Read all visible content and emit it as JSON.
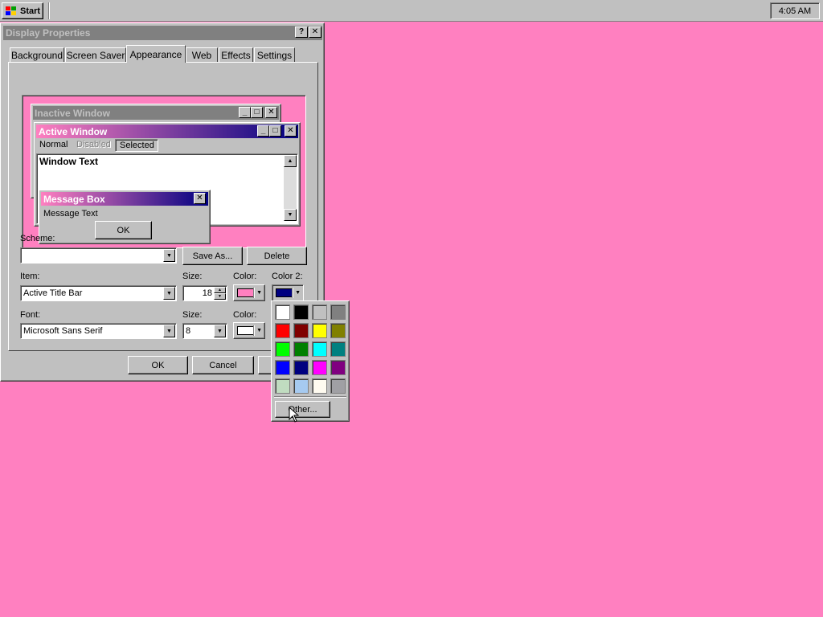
{
  "taskbar": {
    "start_label": "Start",
    "clock": "4:05 AM"
  },
  "dialog": {
    "title": "Display Properties",
    "help_btn": "?",
    "close_btn": "✕",
    "tabs": [
      {
        "label": "Background"
      },
      {
        "label": "Screen Saver"
      },
      {
        "label": "Appearance",
        "active": true
      },
      {
        "label": "Web"
      },
      {
        "label": "Effects"
      },
      {
        "label": "Settings"
      }
    ],
    "preview": {
      "inactive_title": "Inactive Window",
      "active_title": "Active Window",
      "menu_normal": "Normal",
      "menu_disabled": "Disabled",
      "menu_selected": "Selected",
      "window_text": "Window Text",
      "msgbox_title": "Message Box",
      "msgbox_text": "Message Text",
      "msgbox_ok": "OK"
    },
    "scheme": {
      "label": "Scheme:",
      "value": "",
      "save_as": "Save As...",
      "delete": "Delete"
    },
    "item": {
      "label": "Item:",
      "value": "Active Title Bar",
      "size_label": "Size:",
      "size_value": "18",
      "color_label": "Color:",
      "color_value": "#ff80c0",
      "color2_label": "Color 2:",
      "color2_value": "#000080"
    },
    "font": {
      "label": "Font:",
      "value": "Microsoft Sans Serif",
      "size_label": "Size:",
      "size_value": "8",
      "color_label": "Color:",
      "color_value": "#ffffff"
    },
    "buttons": {
      "ok": "OK",
      "cancel": "Cancel"
    }
  },
  "palette": {
    "colors": [
      "#ffffff",
      "#000000",
      "#c0c0c0",
      "#808080",
      "#ff0000",
      "#800000",
      "#ffff00",
      "#808000",
      "#00ff00",
      "#008000",
      "#00ffff",
      "#008080",
      "#0000ff",
      "#000080",
      "#ff00ff",
      "#800080",
      "#c0dcc0",
      "#a6caf0",
      "#fffbf0",
      "#a0a0a4"
    ],
    "other_label": "Other..."
  },
  "colors": {
    "desktop": "#ff80c0",
    "face": "#c0c0c0",
    "title_inactive": "#808080"
  }
}
